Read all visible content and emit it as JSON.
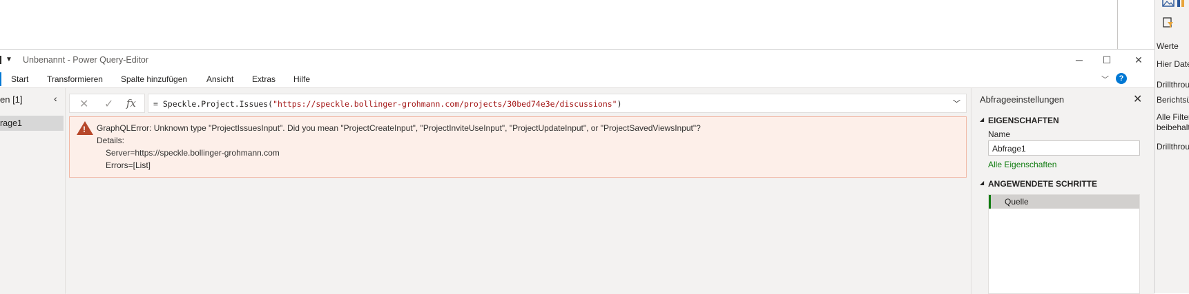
{
  "background_app": {
    "right_pane": {
      "items": [
        "Werte",
        "Hier Daten",
        "Drillthroug",
        "Berichtsübe",
        "Alle Filter",
        "beibehalten",
        "Drillthroug"
      ]
    },
    "icons": [
      "image-icon",
      "chart-icon",
      "filter-icon"
    ]
  },
  "window": {
    "title": "Unbenannt - Power Query-Editor",
    "controls": {
      "minimize": "─",
      "maximize": "☐",
      "close": "✕"
    }
  },
  "ribbon": {
    "tabs": [
      "Start",
      "Transformieren",
      "Spalte hinzufügen",
      "Ansicht",
      "Extras",
      "Hilfe"
    ],
    "help": "?"
  },
  "queries_pane": {
    "header": "en [1]",
    "item": "rage1"
  },
  "formula_bar": {
    "prefix": "= Speckle.Project.Issues(",
    "argument": "\"https://speckle.bollinger-grohmann.com/projects/30bed74e3e/discussions\"",
    "suffix": ")"
  },
  "error": {
    "message": "GraphQLError: Unknown type \"ProjectIssuesInput\". Did you mean \"ProjectCreateInput\", \"ProjectInviteUseInput\", \"ProjectUpdateInput\", or \"ProjectSavedViewsInput\"?",
    "details_label": "Details:",
    "server": "Server=https://speckle.bollinger-grohmann.com",
    "errors": "Errors=[List]",
    "accent_color": "#b7472a"
  },
  "settings_pane": {
    "title": "Abfrageeinstellungen",
    "properties_header": "EIGENSCHAFTEN",
    "name_label": "Name",
    "name_value": "Abfrage1",
    "all_properties_link": "Alle Eigenschaften",
    "steps_header": "ANGEWENDETE SCHRITTE",
    "steps": [
      "Quelle"
    ],
    "accent_color": "#107c10"
  }
}
